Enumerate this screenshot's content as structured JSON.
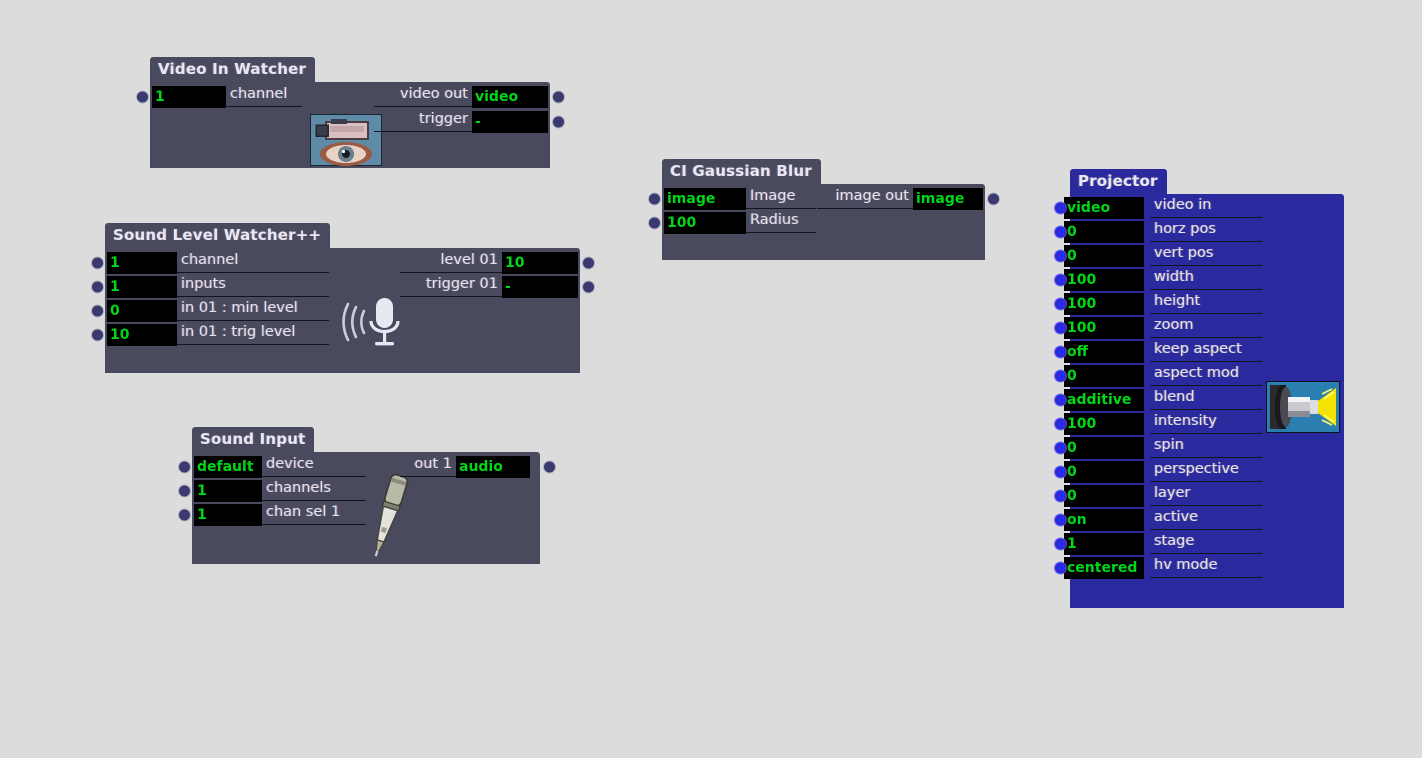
{
  "canvas": {
    "background_color": "#dcdcdc",
    "node_body_color": "#4a4a5e",
    "projector_body_color": "#2a2a9e",
    "value_text_color": "#00d816",
    "value_field_color": "#000000",
    "label_text_color": "#e2e2ee"
  },
  "nodes": {
    "video_in_watcher": {
      "title": "Video In Watcher",
      "icon": "video-camera-eye-icon",
      "inputs": [
        {
          "value": "1",
          "label": "channel"
        }
      ],
      "outputs": [
        {
          "label": "video out",
          "value": "video"
        },
        {
          "label": "trigger",
          "value": "-"
        }
      ]
    },
    "sound_level_watcher": {
      "title": "Sound Level Watcher++",
      "icon": "microphone-waves-icon",
      "inputs": [
        {
          "value": "1",
          "label": "channel"
        },
        {
          "value": "1",
          "label": "inputs"
        },
        {
          "value": "0",
          "label": "in 01 : min level"
        },
        {
          "value": "10",
          "label": "in 01 : trig level"
        }
      ],
      "outputs": [
        {
          "label": "level 01",
          "value": "10"
        },
        {
          "label": "trigger 01",
          "value": "-"
        }
      ]
    },
    "sound_input": {
      "title": "Sound Input",
      "icon": "condenser-microphone-icon",
      "inputs": [
        {
          "value": "default",
          "label": "device"
        },
        {
          "value": "1",
          "label": "channels"
        },
        {
          "value": "1",
          "label": "chan sel 1"
        }
      ],
      "outputs": [
        {
          "label": "out 1",
          "value": "audio"
        }
      ]
    },
    "ci_gaussian_blur": {
      "title": "CI Gaussian Blur",
      "inputs": [
        {
          "value": "image",
          "label": "Image"
        },
        {
          "value": "100",
          "label": "Radius"
        }
      ],
      "outputs": [
        {
          "label": "image out",
          "value": "image"
        }
      ]
    },
    "projector": {
      "title": "Projector",
      "icon": "projector-beam-icon",
      "inputs": [
        {
          "value": "video",
          "label": "video in"
        },
        {
          "value": "0",
          "label": "horz pos"
        },
        {
          "value": "0",
          "label": "vert pos"
        },
        {
          "value": "100",
          "label": "width"
        },
        {
          "value": "100",
          "label": "height"
        },
        {
          "value": "100",
          "label": "zoom"
        },
        {
          "value": "off",
          "label": "keep aspect"
        },
        {
          "value": "0",
          "label": "aspect mod"
        },
        {
          "value": "additive",
          "label": "blend"
        },
        {
          "value": "100",
          "label": "intensity"
        },
        {
          "value": "0",
          "label": "spin"
        },
        {
          "value": "0",
          "label": "perspective"
        },
        {
          "value": "0",
          "label": "layer"
        },
        {
          "value": "on",
          "label": "active"
        },
        {
          "value": "1",
          "label": "stage"
        },
        {
          "value": "centered",
          "label": "hv mode"
        }
      ],
      "outputs": []
    }
  }
}
